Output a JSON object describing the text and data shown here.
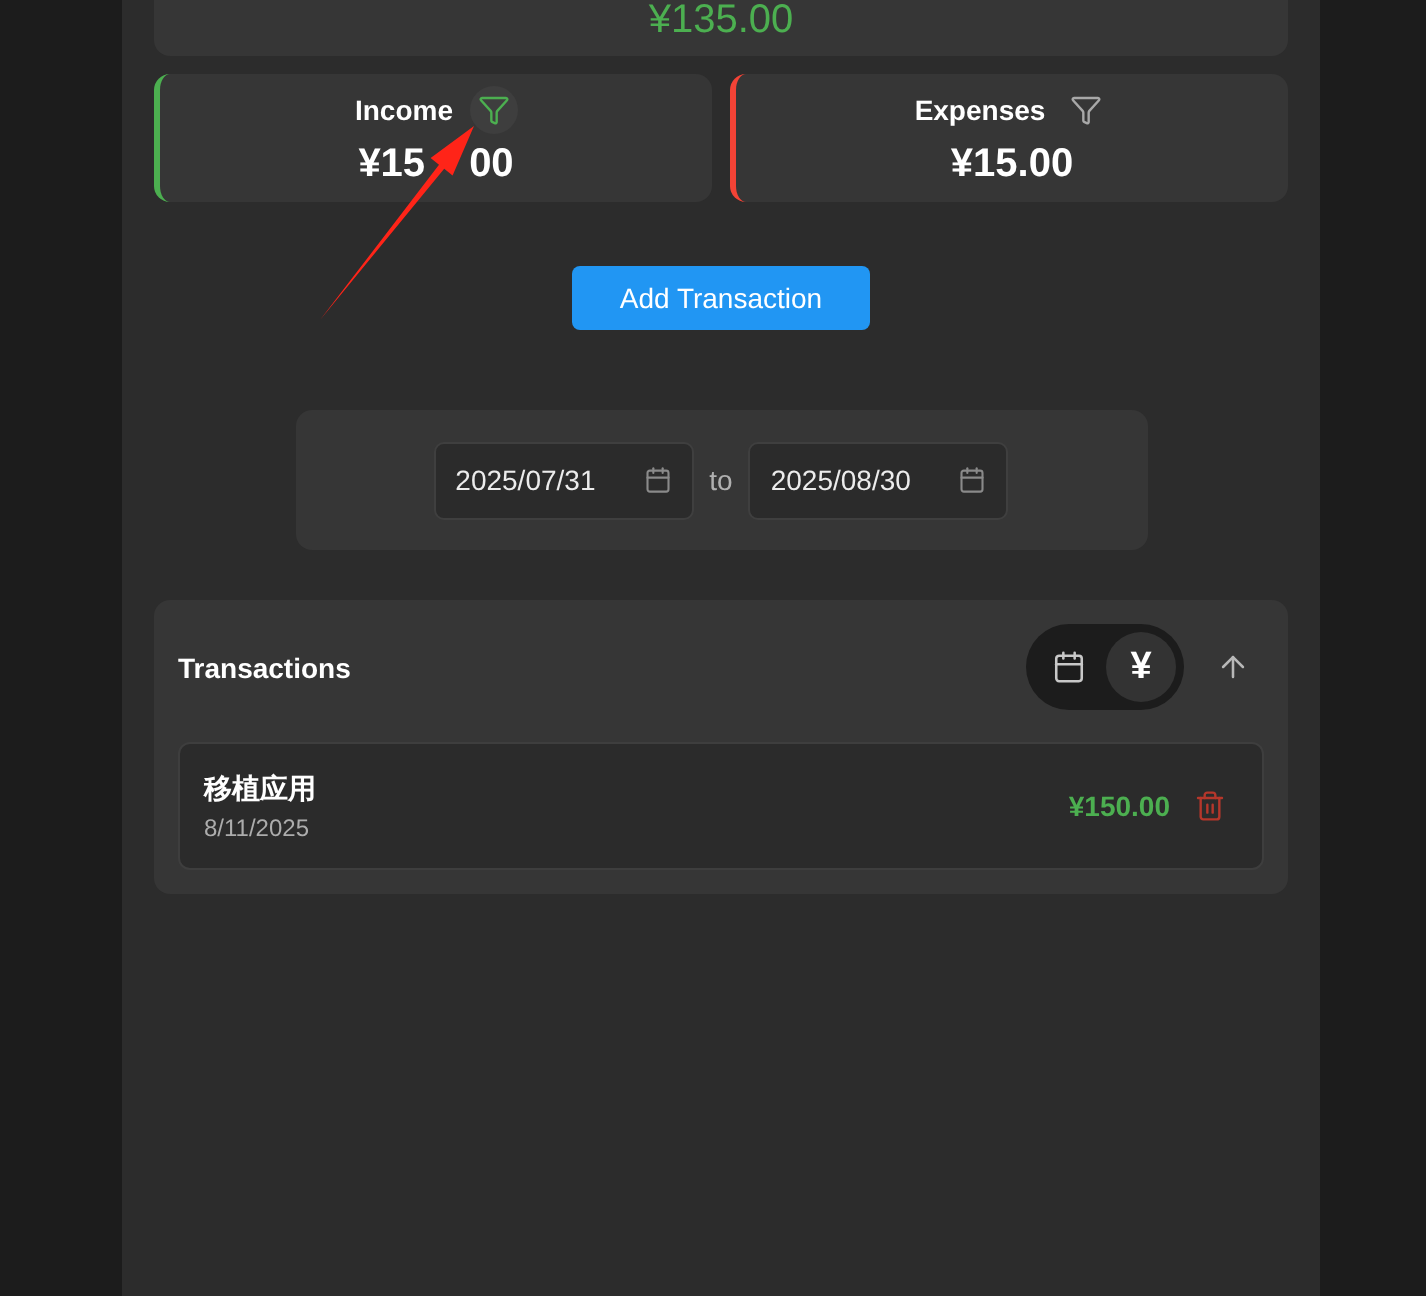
{
  "balance": {
    "amount": "¥135.00"
  },
  "summary": [
    {
      "kind": "income",
      "label": "Income",
      "amount_parts": [
        "¥15",
        "00"
      ],
      "filter_active": true
    },
    {
      "kind": "expense",
      "label": "Expenses",
      "amount_parts": [
        "¥15.00"
      ],
      "filter_active": false
    }
  ],
  "add_button": "Add Transaction",
  "date_range": {
    "from": "2025/07/31",
    "separator": "to",
    "to": "2025/08/30"
  },
  "transactions": {
    "title": "Transactions",
    "sort_options": [
      {
        "kind": "date",
        "selected": false
      },
      {
        "kind": "amount",
        "label": "¥",
        "selected": true
      }
    ],
    "sort_ascending": true,
    "items": [
      {
        "kind": "income",
        "name": "移植应用",
        "date": "8/11/2025",
        "amount": "¥150.00"
      }
    ]
  }
}
